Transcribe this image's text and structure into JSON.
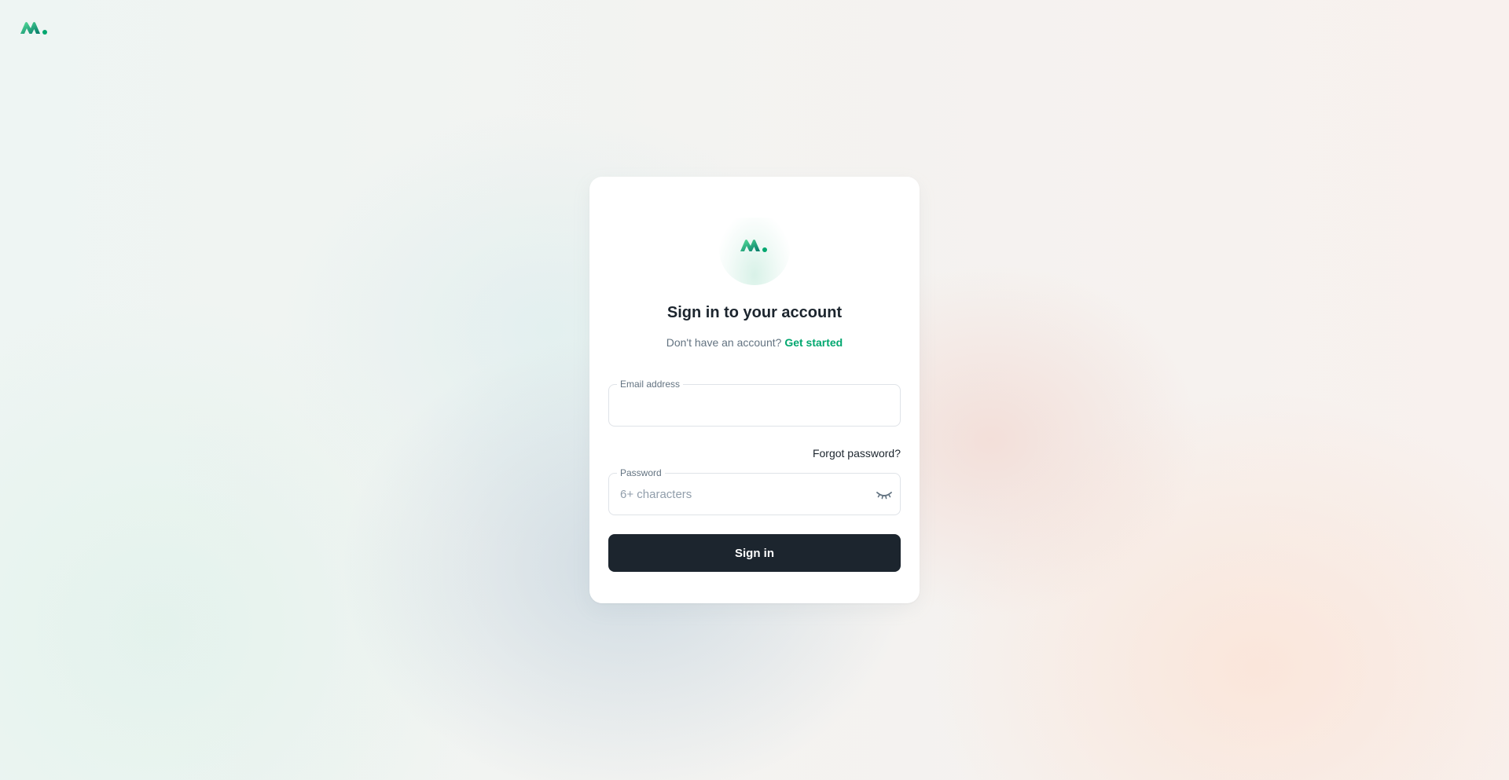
{
  "brand": {
    "logo_icon": "brand-logo-icon",
    "accent_color": "#00a76f",
    "accent_dark": "#007867",
    "accent_light": "#5be49b"
  },
  "signin": {
    "title": "Sign in to your account",
    "subtitle_prefix": "Don't have an account?",
    "subtitle_link": "Get started",
    "email": {
      "label": "Email address",
      "value": "",
      "placeholder": ""
    },
    "forgot_password": "Forgot password?",
    "password": {
      "label": "Password",
      "value": "",
      "placeholder": "6+ characters",
      "toggle_icon": "eye-closed-icon"
    },
    "submit_label": "Sign in",
    "submit_color": "#1c252e"
  }
}
